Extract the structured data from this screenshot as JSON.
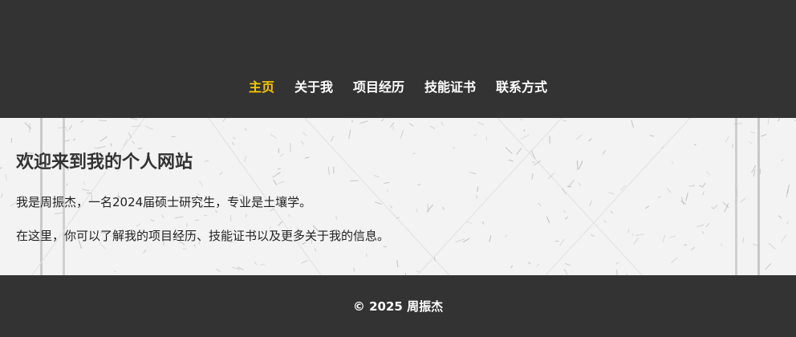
{
  "nav": {
    "items": [
      {
        "label": "主页",
        "active": true
      },
      {
        "label": "关于我",
        "active": false
      },
      {
        "label": "项目经历",
        "active": false
      },
      {
        "label": "技能证书",
        "active": false
      },
      {
        "label": "联系方式",
        "active": false
      }
    ]
  },
  "main": {
    "title": "欢迎来到我的个人网站",
    "paragraphs": [
      "我是周振杰，一名2024届硕士研究生，专业是土壤学。",
      "在这里，你可以了解我的项目经历、技能证书以及更多关于我的信息。"
    ]
  },
  "footer": {
    "copyright": "© 2025 周振杰"
  },
  "colors": {
    "header_bg": "#333333",
    "footer_bg": "#333333",
    "nav_active": "#f7c600",
    "nav_text": "#ffffff",
    "content_bg": "#f3f3f3"
  }
}
